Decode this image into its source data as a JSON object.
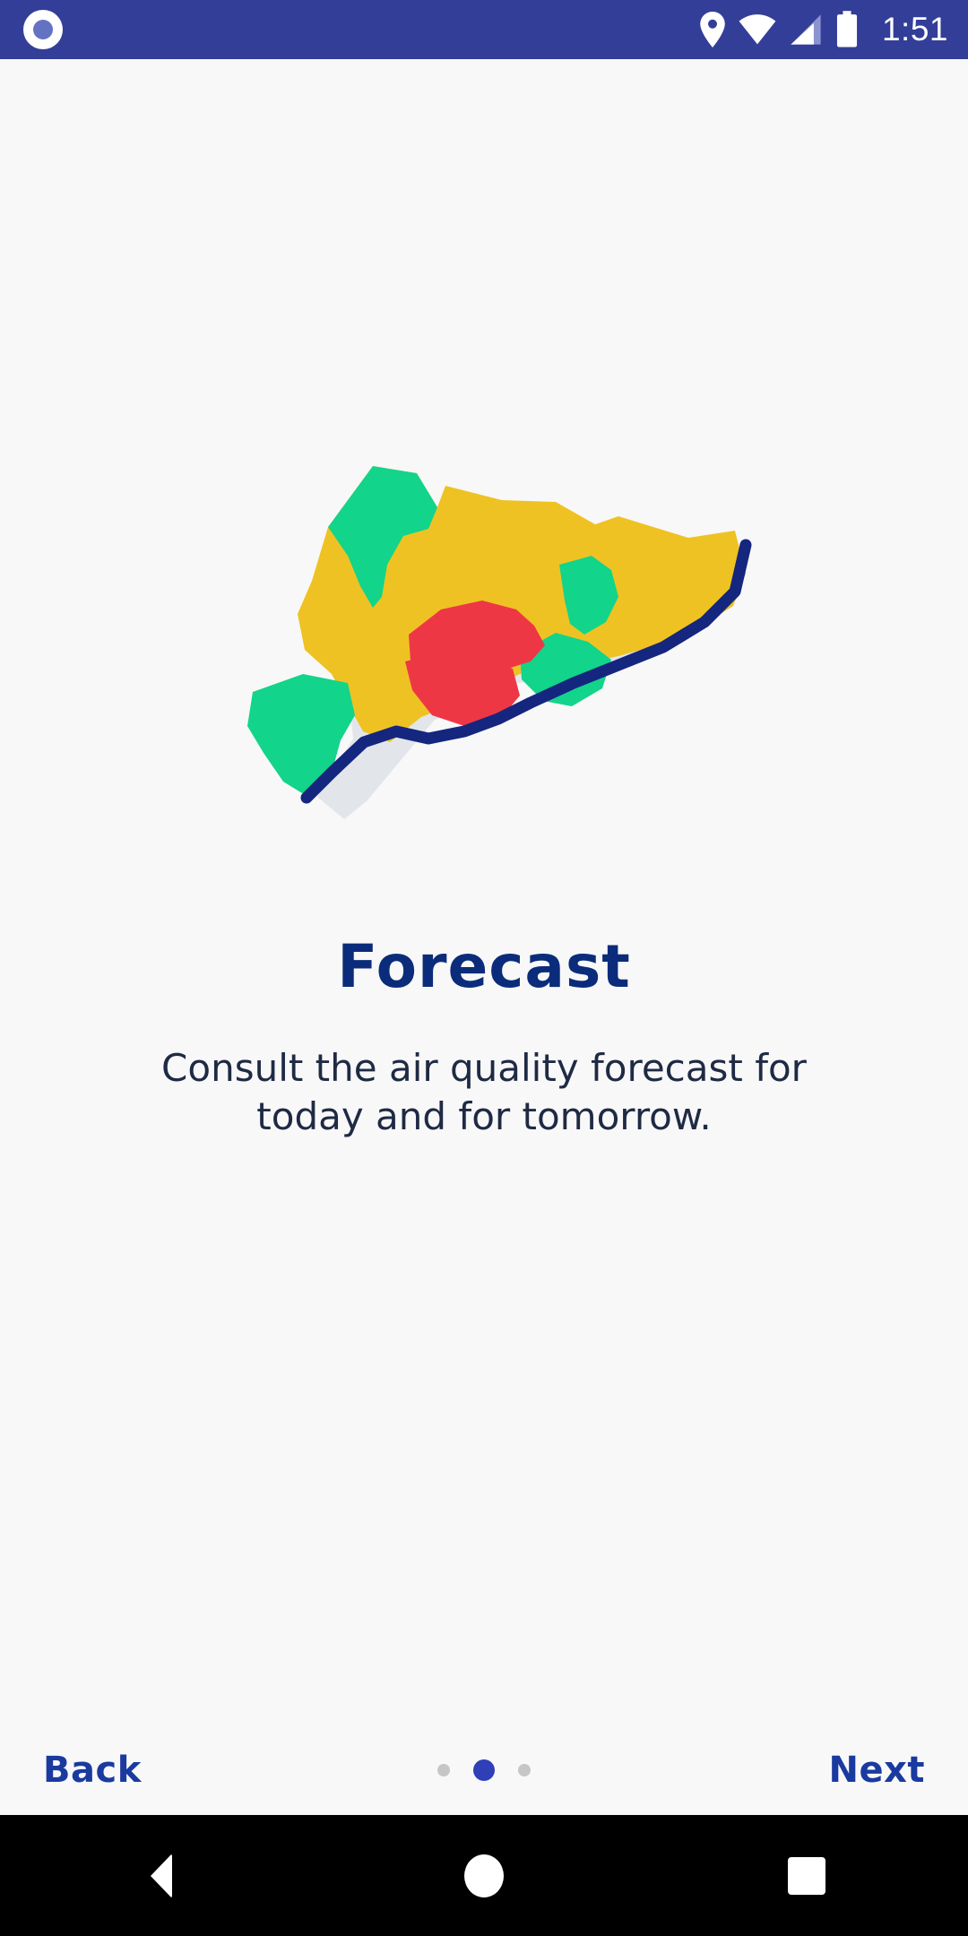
{
  "status_bar": {
    "time": "1:51",
    "background_color": "#333e99",
    "notification_icon": "circle-notification-icon",
    "icons": [
      "location-pin-icon",
      "wifi-icon",
      "cell-signal-icon",
      "battery-icon"
    ]
  },
  "onboarding": {
    "title": "Forecast",
    "subtitle": "Consult the air quality forecast for today and for tomorrow.",
    "title_color": "#0b2c7a",
    "illustration": {
      "name": "catalonia-air-quality-map",
      "colors": {
        "good": "#12d48a",
        "moderate": "#efc223",
        "poor": "#ee3745",
        "coastline": "#15267f",
        "shadow": "#e2e6ea"
      }
    }
  },
  "footer": {
    "back_label": "Back",
    "next_label": "Next",
    "link_color": "#1a3aa0",
    "dots": [
      {
        "active": false
      },
      {
        "active": true
      },
      {
        "active": false
      }
    ],
    "current_page": 2,
    "total_pages": 3
  },
  "system_nav": {
    "back": "back-triangle",
    "home": "home-circle",
    "recents": "recents-square"
  }
}
